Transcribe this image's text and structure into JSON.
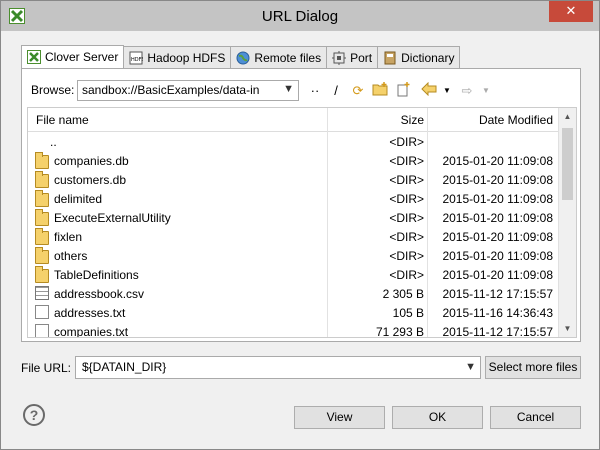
{
  "window": {
    "title": "URL Dialog",
    "close_glyph": "✕"
  },
  "tabs": [
    {
      "label": "Clover Server",
      "icon": "clover-server-icon"
    },
    {
      "label": "Hadoop HDFS",
      "icon": "hdfs-icon"
    },
    {
      "label": "Remote files",
      "icon": "globe-icon"
    },
    {
      "label": "Port",
      "icon": "port-icon"
    },
    {
      "label": "Dictionary",
      "icon": "dictionary-icon"
    }
  ],
  "browse": {
    "label": "Browse:",
    "path": "sandbox://BasicExamples/data-in",
    "toolbar": {
      "up": "··",
      "root": "/",
      "refresh": "⟳",
      "new_folder": "📁",
      "new_file": "📄",
      "back": "⇦",
      "forward": "⇨"
    }
  },
  "table": {
    "headers": {
      "name": "File name",
      "size": "Size",
      "date": "Date Modified"
    },
    "rows": [
      {
        "name": "..",
        "size": "<DIR>",
        "date": "",
        "type": "parent"
      },
      {
        "name": "companies.db",
        "size": "<DIR>",
        "date": "2015-01-20 11:09:08",
        "type": "folder"
      },
      {
        "name": "customers.db",
        "size": "<DIR>",
        "date": "2015-01-20 11:09:08",
        "type": "folder"
      },
      {
        "name": "delimited",
        "size": "<DIR>",
        "date": "2015-01-20 11:09:08",
        "type": "folder"
      },
      {
        "name": "ExecuteExternalUtility",
        "size": "<DIR>",
        "date": "2015-01-20 11:09:08",
        "type": "folder"
      },
      {
        "name": "fixlen",
        "size": "<DIR>",
        "date": "2015-01-20 11:09:08",
        "type": "folder"
      },
      {
        "name": "others",
        "size": "<DIR>",
        "date": "2015-01-20 11:09:08",
        "type": "folder"
      },
      {
        "name": "TableDefinitions",
        "size": "<DIR>",
        "date": "2015-01-20 11:09:08",
        "type": "folder"
      },
      {
        "name": "addressbook.csv",
        "size": "2 305 B",
        "date": "2015-11-12 17:15:57",
        "type": "csv"
      },
      {
        "name": "addresses.txt",
        "size": "105 B",
        "date": "2015-11-16 14:36:43",
        "type": "file"
      },
      {
        "name": "companies.txt",
        "size": "71 293 B",
        "date": "2015-11-12 17:15:57",
        "type": "file"
      }
    ]
  },
  "file_url": {
    "label": "File URL:",
    "value": "${DATAIN_DIR}"
  },
  "buttons": {
    "select_more": "Select more files",
    "view": "View",
    "ok": "OK",
    "cancel": "Cancel",
    "help": "?"
  }
}
